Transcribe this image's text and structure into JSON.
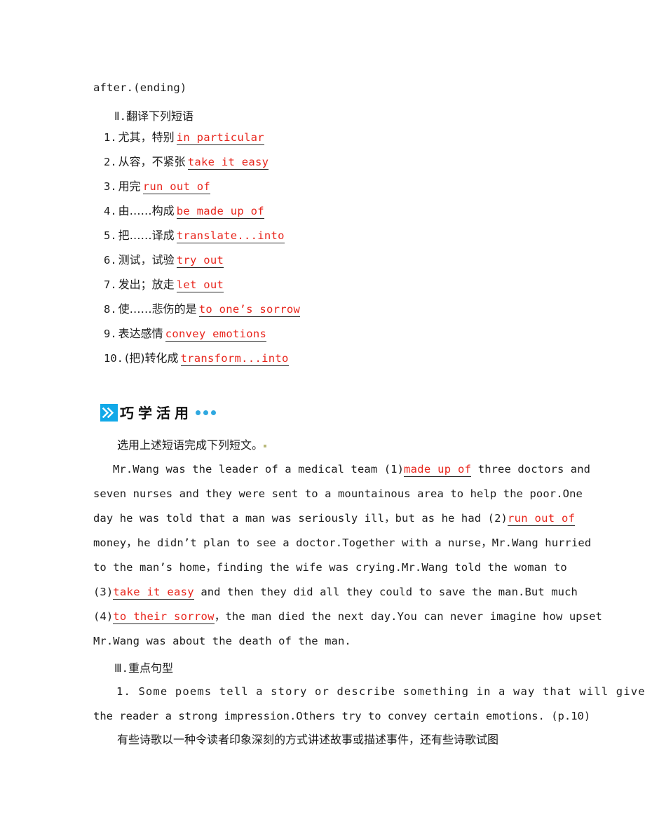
{
  "orphan_line": "after.(ending)",
  "section2": {
    "numeral": "Ⅱ.",
    "title": "翻译下列短语",
    "items": [
      {
        "num": "1.",
        "cn": "尤其，特别",
        "answer": "in particular"
      },
      {
        "num": "2.",
        "cn": "从容，不紧张",
        "answer": "take it easy"
      },
      {
        "num": "3.",
        "cn": "用完",
        "answer": "run out of"
      },
      {
        "num": "4.",
        "cn": "由……构成",
        "answer": "be made up of"
      },
      {
        "num": "5.",
        "cn": "把……译成",
        "answer": "translate...into"
      },
      {
        "num": "6.",
        "cn": "测试，试验",
        "answer": "try out"
      },
      {
        "num": "7.",
        "cn": "发出；放走",
        "answer": "let out"
      },
      {
        "num": "8.",
        "cn": "使……悲伤的是",
        "answer": "to one’s sorrow"
      },
      {
        "num": "9.",
        "cn": "表达感情",
        "answer": "convey emotions"
      },
      {
        "num": "10.",
        "cn": "(把)转化成",
        "answer": "transform...into"
      }
    ]
  },
  "banner": {
    "badge_icon": "double-chevron-right-icon",
    "title": "巧学活用",
    "badge_color": "#12a9e8",
    "dot_color": "#2fa8e0",
    "dots": 3
  },
  "instruction": "选用上述短语完成下列短文。",
  "cloze": {
    "lines": [
      {
        "indent": true,
        "parts": [
          {
            "type": "text",
            "text": "Mr.Wang was the leader of a medical team "
          },
          {
            "type": "num",
            "text": "(1)"
          },
          {
            "type": "fill",
            "text": "made up of"
          },
          {
            "type": "text",
            "text": " three doctors and"
          }
        ]
      },
      {
        "indent": false,
        "parts": [
          {
            "type": "text",
            "text": "seven nurses and they were sent to a mountainous area to help the poor.One"
          }
        ]
      },
      {
        "indent": false,
        "parts": [
          {
            "type": "text",
            "text": "day he was told that a man was seriously ill，but as he had "
          },
          {
            "type": "num",
            "text": "(2)"
          },
          {
            "type": "fill",
            "text": "run out of"
          }
        ]
      },
      {
        "indent": false,
        "parts": [
          {
            "type": "text",
            "text": "money，he didn’t plan to see a doctor.Together with a nurse，Mr.Wang hurried"
          }
        ]
      },
      {
        "indent": false,
        "parts": [
          {
            "type": "text",
            "text": "to the man’s home，finding the wife was crying.Mr.Wang told the woman to"
          }
        ]
      },
      {
        "indent": false,
        "parts": [
          {
            "type": "num",
            "text": "(3)"
          },
          {
            "type": "fill",
            "text": "take it easy"
          },
          {
            "type": "text",
            "text": " and then they did all they could to save the man.But much"
          }
        ]
      },
      {
        "indent": false,
        "parts": [
          {
            "type": "num",
            "text": "(4)"
          },
          {
            "type": "fill",
            "text": "to their sorrow"
          },
          {
            "type": "text",
            "text": "，the man died the next day.You can never imagine how upset"
          }
        ]
      },
      {
        "indent": false,
        "parts": [
          {
            "type": "text",
            "text": "Mr.Wang was about the death of the man."
          }
        ]
      }
    ]
  },
  "section3": {
    "numeral": "Ⅲ.",
    "title": "重点句型",
    "sentence_lines": [
      {
        "indent": true,
        "wide": true,
        "text": "1. Some poems tell a story or describe something in a way that will give"
      },
      {
        "indent": false,
        "wide": false,
        "text": "the reader a strong impression.Others try to convey certain emotions. (p.10)"
      }
    ],
    "translation": "有些诗歌以一种令读者印象深刻的方式讲述故事或描述事件，还有些诗歌试图"
  }
}
